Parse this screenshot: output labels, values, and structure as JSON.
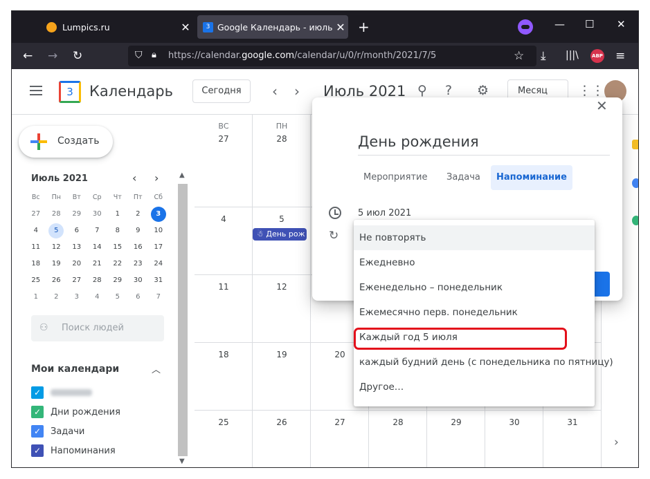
{
  "browser": {
    "tabs": [
      {
        "label": "Lumpics.ru",
        "close": "✕"
      },
      {
        "label": "Google Календарь - июль 2021",
        "close": "✕",
        "icon_text": "3"
      }
    ],
    "new_tab": "+",
    "window_controls": [
      "—",
      "☐",
      "✕"
    ],
    "url_prefix": "https://calendar.",
    "url_domain": "google.com",
    "url_rest": "/calendar/u/0/r/month/2021/7/5",
    "abp": "ABP"
  },
  "header": {
    "logo_text": "3",
    "app_name": "Календарь",
    "today_button": "Сегодня",
    "month_title": "Июль 2021",
    "view_select": "Месяц"
  },
  "sidebar": {
    "create_label": "Создать",
    "mini_title": "Июль 2021",
    "weekdays": [
      "Вс",
      "Пн",
      "Вт",
      "Ср",
      "Чт",
      "Пт",
      "Сб"
    ],
    "days": [
      [
        "27",
        "28",
        "29",
        "30",
        "1",
        "2",
        "3"
      ],
      [
        "4",
        "5",
        "6",
        "7",
        "8",
        "9",
        "10"
      ],
      [
        "11",
        "12",
        "13",
        "14",
        "15",
        "16",
        "17"
      ],
      [
        "18",
        "19",
        "20",
        "21",
        "22",
        "23",
        "24"
      ],
      [
        "25",
        "26",
        "27",
        "28",
        "29",
        "30",
        "31"
      ],
      [
        "1",
        "2",
        "3",
        "4",
        "5",
        "6",
        "7"
      ]
    ],
    "people_search": "Поиск людей",
    "my_calendars": "Мои календари",
    "calendars": [
      {
        "label": "",
        "color": "#039be5"
      },
      {
        "label": "Дни рождения",
        "color": "#33b679"
      },
      {
        "label": "Задачи",
        "color": "#4285f4"
      },
      {
        "label": "Напоминания",
        "color": "#3f51b5"
      }
    ]
  },
  "grid": {
    "dow": [
      "ВС",
      "ПН"
    ],
    "rows": [
      [
        "27",
        "28"
      ],
      [
        "4",
        "5"
      ],
      [
        "11",
        "12"
      ],
      [
        "18",
        "19",
        "20"
      ],
      [
        "25",
        "26",
        "27",
        "28",
        "29",
        "30",
        "31"
      ]
    ],
    "event_chip": "День рож"
  },
  "dialog": {
    "title": "День рождения",
    "tabs": [
      "Мероприятие",
      "Задача",
      "Напоминание"
    ],
    "active_tab": "Напоминание",
    "date": "5 июл 2021"
  },
  "repeat_menu": {
    "items": [
      "Не повторять",
      "Ежедневно",
      "Еженедельно – понедельник",
      "Ежемесячно перв. понедельник",
      "Каждый год 5 июля",
      "каждый будний день (с понедельника по пятницу)",
      "Другое…"
    ],
    "highlighted": "Каждый год 5 июля"
  },
  "colors": {
    "accent": "#1a73e8",
    "highlight_box": "#e3101b",
    "event_chip": "#3f51b5"
  }
}
